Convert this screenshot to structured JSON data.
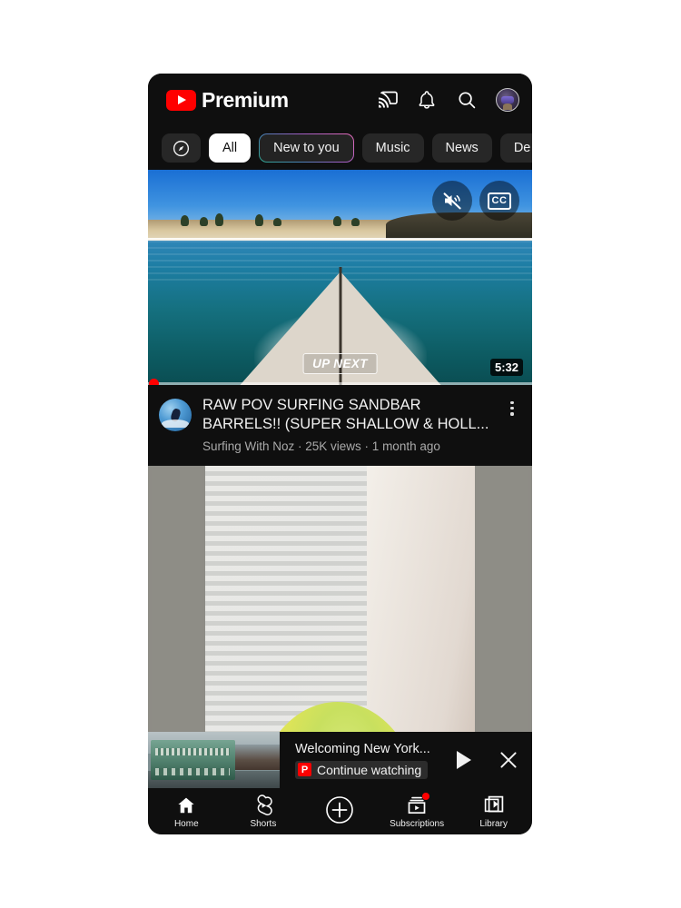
{
  "app": {
    "brand": "Premium",
    "logo_icon": "youtube-play-logo",
    "accent_color": "#ff0000",
    "background_color": "#0f0f0f"
  },
  "topbar": {
    "icons": [
      {
        "name": "cast-icon",
        "label": "Cast"
      },
      {
        "name": "notifications-bell-icon",
        "label": "Notifications"
      },
      {
        "name": "search-icon",
        "label": "Search"
      },
      {
        "name": "account-avatar",
        "label": "Account"
      }
    ]
  },
  "chips": [
    {
      "label": "",
      "icon": "explore-compass-icon",
      "state": "icon"
    },
    {
      "label": "All",
      "state": "active"
    },
    {
      "label": "New to you",
      "state": "gradient"
    },
    {
      "label": "Music",
      "state": "default"
    },
    {
      "label": "News",
      "state": "default"
    },
    {
      "label": "De",
      "state": "truncated"
    }
  ],
  "feed": [
    {
      "type": "video",
      "title": "RAW POV SURFING SANDBAR BARRELS!! (SUPER SHALLOW & HOLL...",
      "channel": "Surfing With Noz",
      "views": "25K views",
      "age": "1 month ago",
      "meta_line": "Surfing With Noz · 25K views · 1 month ago",
      "duration": "5:32",
      "badge": "UP NEXT",
      "overlay_controls": [
        {
          "name": "mute-button",
          "icon": "muted-speaker-icon"
        },
        {
          "name": "captions-button",
          "icon": "cc-icon",
          "label": "CC"
        }
      ],
      "menu_icon": "more-vertical-icon",
      "progress_percent": 1
    },
    {
      "type": "shorts-video",
      "description": "yellow budgerigar parakeet close-up"
    }
  ],
  "miniplayer": {
    "title": "Welcoming New York...",
    "badge_letter": "P",
    "status": "Continue watching",
    "play_icon": "play-icon",
    "close_icon": "close-x-icon"
  },
  "bottom_nav": [
    {
      "label": "Home",
      "icon": "home-icon",
      "active": true,
      "badge": false
    },
    {
      "label": "Shorts",
      "icon": "shorts-icon",
      "active": false,
      "badge": false
    },
    {
      "label": "",
      "icon": "create-plus-icon",
      "active": false,
      "badge": false
    },
    {
      "label": "Subscriptions",
      "icon": "subscriptions-icon",
      "active": false,
      "badge": true
    },
    {
      "label": "Library",
      "icon": "library-icon",
      "active": false,
      "badge": false
    }
  ]
}
